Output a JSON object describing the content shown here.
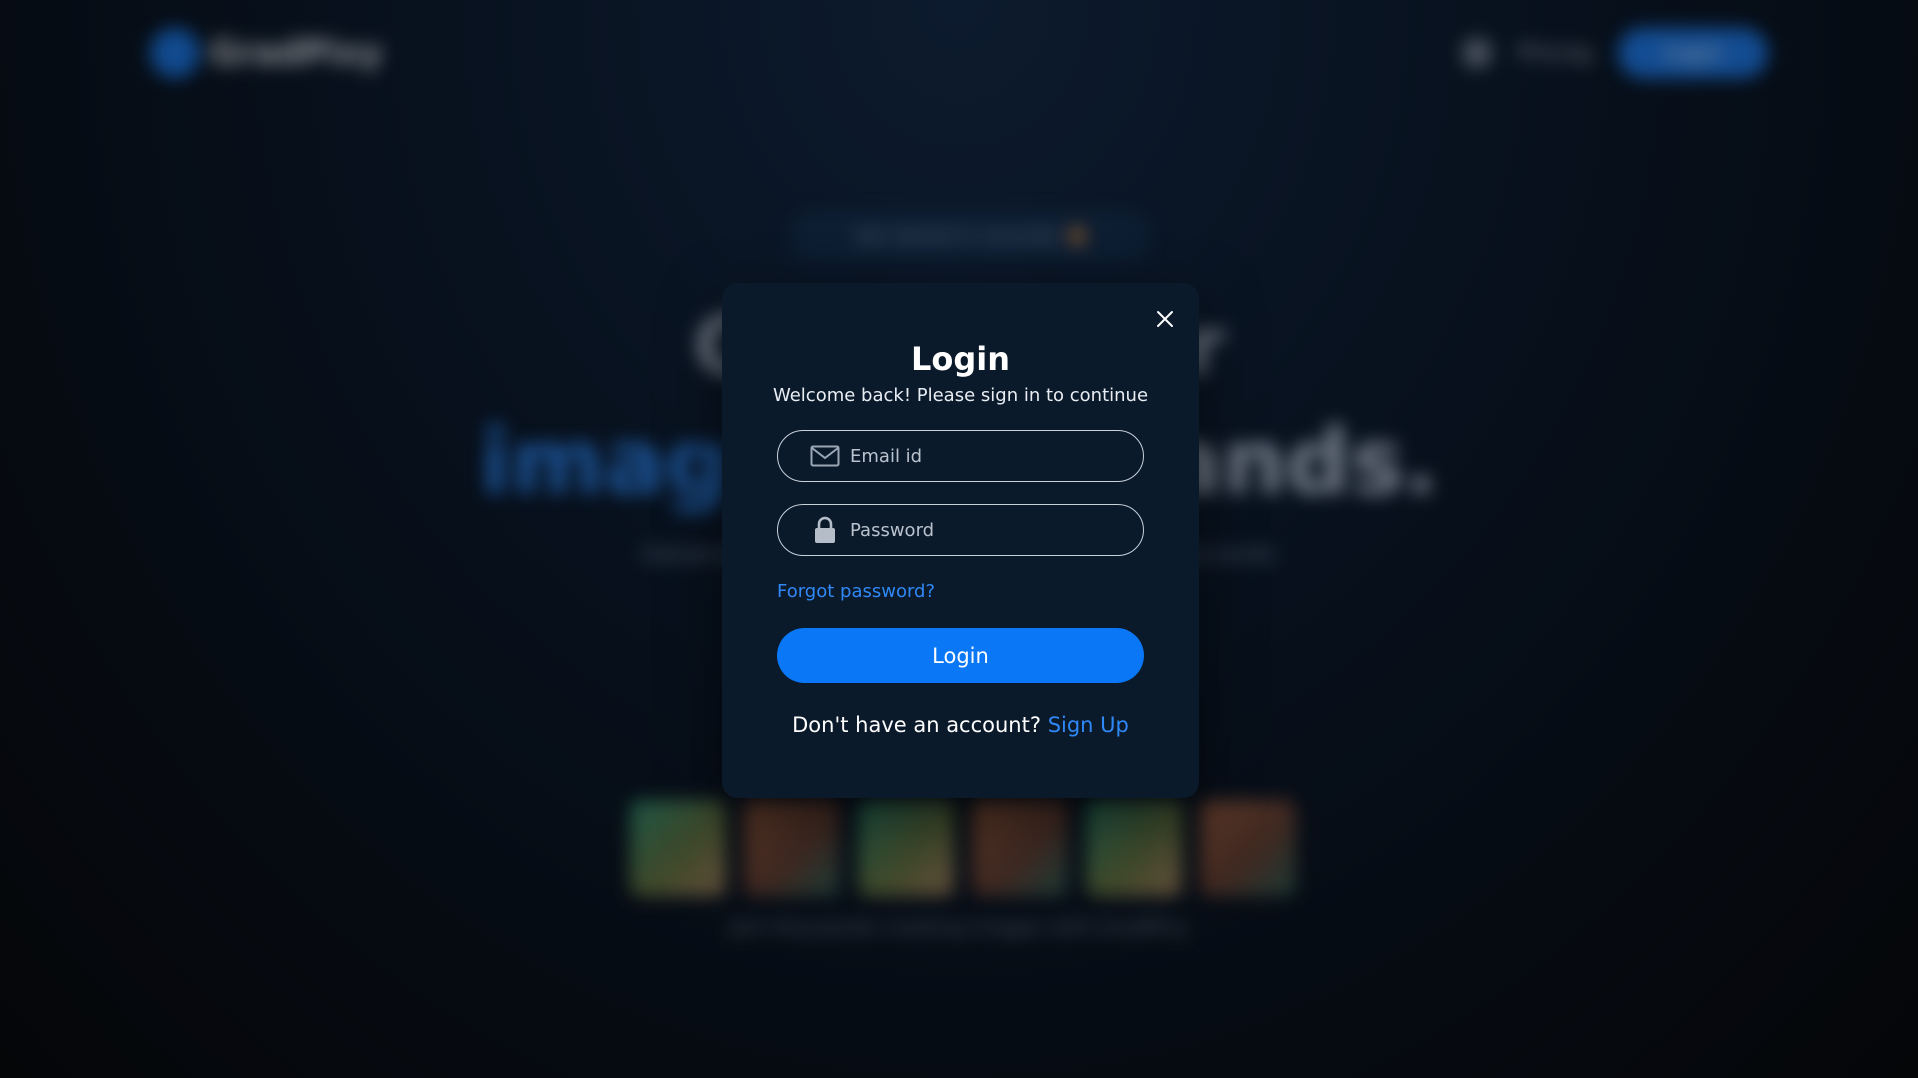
{
  "background": {
    "logo_text": "GradPixy",
    "nav_link": "Pricing",
    "nav_button": "Login",
    "pill_text": "Get started in seconds",
    "headline_line1": "Create your",
    "headline_line2_highlight": "images",
    "headline_line2_rest": " for brands.",
    "subtext": "Generate stunning images for your brand in seconds",
    "caption": "Join thousands creating images with GradPixy"
  },
  "modal": {
    "title": "Login",
    "subtitle": "Welcome back! Please sign in to continue",
    "email_placeholder": "Email id",
    "password_placeholder": "Password",
    "forgot_password": "Forgot password?",
    "login_button": "Login",
    "signup_prompt": "Don't have an account?",
    "signup_link": "Sign Up",
    "icons": {
      "close": "close-icon",
      "email": "mail-icon",
      "password": "lock-icon"
    }
  },
  "colors": {
    "accent": "#0a78f6",
    "link": "#2f88f6",
    "modal_bg": "#0b1a2b"
  }
}
